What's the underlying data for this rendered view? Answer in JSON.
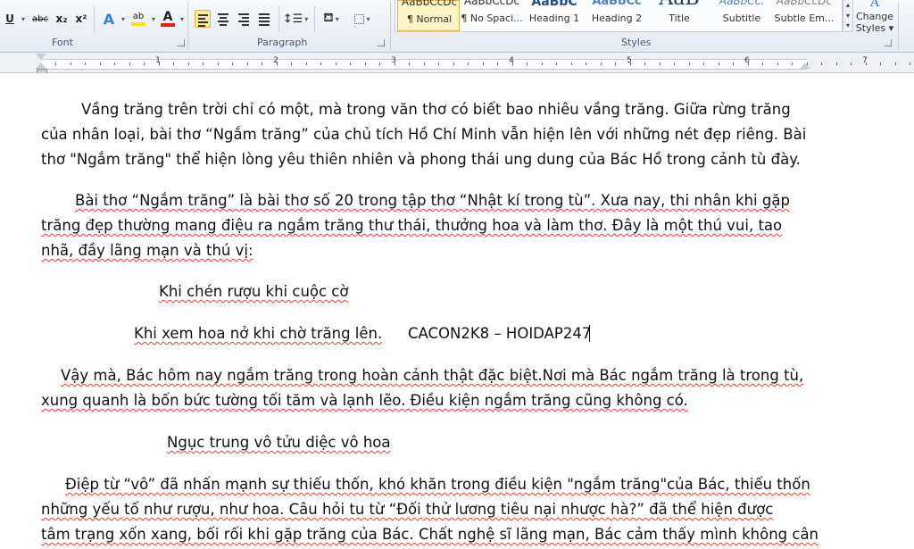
{
  "ribbon": {
    "font_group_label": "Font",
    "paragraph_group_label": "Paragraph",
    "styles_group_label": "Styles",
    "font_buttons": {
      "underline": "U",
      "strikethrough": "abc",
      "subscript": "x₂",
      "superscript": "x²",
      "text_effects": "A",
      "highlight": "ab",
      "font_color": "A"
    },
    "styles": [
      {
        "preview": "AaBbCcDc",
        "name": "¶ Normal"
      },
      {
        "preview": "AaBbCcDc",
        "name": "¶ No Spaci..."
      },
      {
        "preview": "AaBbC",
        "name": "Heading 1"
      },
      {
        "preview": "AaBbCc",
        "name": "Heading 2"
      },
      {
        "preview": "AaB",
        "name": "Title"
      },
      {
        "preview": "AaBbCc.",
        "name": "Subtitle"
      },
      {
        "preview": "AaBbCcDc",
        "name": "Subtle Em..."
      }
    ],
    "change_styles_line1": "Change",
    "change_styles_line2": "Styles ▾"
  },
  "ruler": {
    "numbers": [
      "1",
      "2",
      "3",
      "4",
      "5",
      "6",
      "7"
    ]
  },
  "document": {
    "p1": [
      "Vầng trăng trên trời chỉ có một, mà trong văn thơ có biết bao nhiêu vầng trăng. Giữa rừng trăng",
      "của nhân loại, bài thơ “Ngắm trăng” của chủ tích Hồ Chí Minh vẫn hiện lên với những nét đẹp riêng. Bài",
      "thơ \"Ngắm trăng\" thể hiện lòng yêu thiên nhiên và phong thái ung dung của Bác Hồ trong cảnh tù đày."
    ],
    "p2": [
      "Bài thơ “Ngắm trăng” là bài thơ số 20 trong tập thơ “Nhật kí trong tù”. Xưa nay, thi nhân khi gặp",
      "trăng đẹp thường mang điệu ra ngắm trăng thư thái, thưởng hoa và làm thơ. Đây là một thú vui, tao",
      "nhã, đầy lãng mạn và thú vị:"
    ],
    "verse1": "Khi chén rượu khi cuộc cờ",
    "verse2": "Khi xem hoa nở khi chờ trăng lên.",
    "watermark": "CACON2K8 – HOIDAP247",
    "p3": [
      "Vậy mà, Bác hôm nay ngắm trăng trong hoàn cảnh thật đặc biệt.Nơi mà Bác ngắm trăng là trong tù,",
      "xung quanh là bốn bức tường tối tăm và lạnh lẽo. Điều kiện ngắm trăng cũng không có."
    ],
    "verse3": "Ngục trung vô tửu diệc vô hoa",
    "p4": [
      "Điệp từ “vô” đã nhấn mạnh sự thiếu thốn, khó khăn trong điều kiện \"ngắm trăng\"của Bác, thiếu thốn",
      "những yếu tố như rượu, như hoa. Câu hỏi tu từ “Đối thử lương tiêu nại nhược hà?” đã thể hiện được",
      "tâm trạng xốn xang, bối rối khi gặp trăng của Bác. Chất nghệ sĩ lãng mạn, Bác cảm thấy mình không cân"
    ]
  },
  "colors": {
    "highlight": "#f5e61c",
    "font_color": "#d9261c",
    "text_effects": "#3b7dd8",
    "selected_style": "#fef4c6",
    "spell_squiggle": "#e23b3b",
    "grammar_squiggle": "#3a62c8"
  }
}
